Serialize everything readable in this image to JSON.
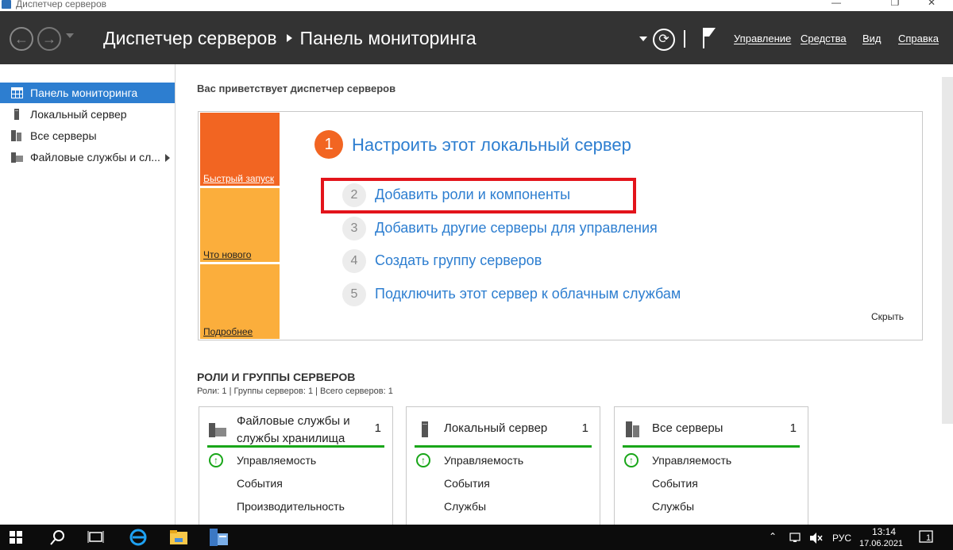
{
  "window": {
    "title": "Диспетчер серверов"
  },
  "header": {
    "breadcrumb_root": "Диспетчер серверов",
    "breadcrumb_current": "Панель мониторинга",
    "menu": {
      "manage": "Управление",
      "tools": "Средства",
      "view": "Вид",
      "help": "Справка"
    }
  },
  "sidebar": {
    "items": [
      {
        "label": "Панель мониторинга",
        "icon": "dashboard-icon",
        "active": true
      },
      {
        "label": "Локальный сервер",
        "icon": "server-icon"
      },
      {
        "label": "Все серверы",
        "icon": "servers-icon"
      },
      {
        "label": "Файловые службы и сл...",
        "icon": "file-services-icon"
      }
    ]
  },
  "welcome": {
    "title": "Вас приветствует диспетчер серверов",
    "tiles": {
      "quick_start": "Быстрый запуск",
      "whats_new": "Что нового",
      "learn_more": "Подробнее"
    },
    "step1": {
      "number": "1",
      "label": "Настроить этот локальный сервер"
    },
    "steps": [
      {
        "number": "2",
        "label": "Добавить роли и компоненты"
      },
      {
        "number": "3",
        "label": "Добавить другие серверы для управления"
      },
      {
        "number": "4",
        "label": "Создать группу серверов"
      },
      {
        "number": "5",
        "label": "Подключить этот сервер к облачным службам"
      }
    ],
    "hide": "Скрыть"
  },
  "roles": {
    "title": "РОЛИ И ГРУППЫ СЕРВЕРОВ",
    "summary": "Роли: 1 | Группы серверов: 1 | Всего серверов: 1",
    "cards": [
      {
        "title_line1": "Файловые службы и",
        "title_line2": "службы хранилища",
        "count": "1",
        "rows": [
          "Управляемость",
          "События",
          "Производительность"
        ]
      },
      {
        "title_line1": "Локальный сервер",
        "title_line2": "",
        "count": "1",
        "rows": [
          "Управляемость",
          "События",
          "Службы"
        ]
      },
      {
        "title_line1": "Все серверы",
        "title_line2": "",
        "count": "1",
        "rows": [
          "Управляемость",
          "События",
          "Службы"
        ]
      }
    ]
  },
  "taskbar": {
    "language": "РУС",
    "time": "13:14",
    "date": "17.06.2021",
    "notifications": "1"
  },
  "colors": {
    "header_bg": "#333333",
    "accent_blue": "#2d7ed0",
    "orange": "#f26522",
    "light_orange": "#fbae3c",
    "highlight_red": "#e3141b",
    "status_green": "#19a619"
  }
}
